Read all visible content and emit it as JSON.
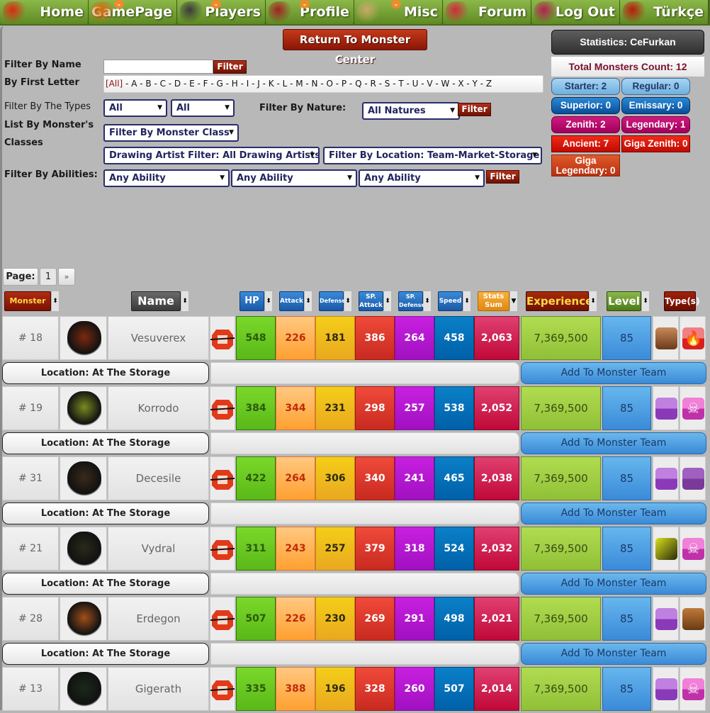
{
  "nav": [
    {
      "label": "Home",
      "dropdown": false,
      "sprite_color": "#d82a10"
    },
    {
      "label": "GamePage",
      "dropdown": true,
      "sprite_color": "#d86a10"
    },
    {
      "label": "Players",
      "dropdown": true,
      "sprite_color": "#3a3a3a"
    },
    {
      "label": "Profile",
      "dropdown": true,
      "sprite_color": "#a02020"
    },
    {
      "label": "Misc",
      "dropdown": true,
      "sprite_color": "#c8a868"
    },
    {
      "label": "Forum",
      "dropdown": false,
      "sprite_color": "#d02a3a"
    },
    {
      "label": "Log Out",
      "dropdown": false,
      "sprite_color": "#b02050"
    },
    {
      "label": "Türkçe",
      "dropdown": false,
      "sprite_color": "#b81a0a"
    }
  ],
  "return_button": "Return To Monster Center",
  "filters": {
    "name_label": "Filter By Name",
    "name_value": "",
    "filter_button": "Filter",
    "first_letter_label": "By First Letter",
    "letters_all": "[All]",
    "letters": "- A - B - C - D - E - F - G - H - I - J - K - L - M - N - O - P - Q - R - S - T - U - V - W - X - Y - Z",
    "types_label": "Filter By The Types",
    "type1": "All",
    "type2": "All",
    "nature_label": "Filter By Nature:",
    "nature": "All Natures",
    "classes_label_1": "List By Monster's",
    "classes_label_2": "Classes",
    "monster_class": "Filter By Monster Class",
    "artist": "Drawing Artist Filter: All Drawing Artists",
    "location": "Filter By Location: Team-Market-Storage",
    "abilities_label": "Filter By Abilities:",
    "ability1": "Any Ability",
    "ability2": "Any Ability",
    "ability3": "Any Ability"
  },
  "statistics": {
    "title": "Statistics: CeFurkan",
    "total": "Total Monsters Count: 12",
    "counts": [
      {
        "label": "Starter: 2",
        "style": "light"
      },
      {
        "label": "Regular: 0",
        "style": "light"
      },
      {
        "label": "Superior: 0",
        "style": "blue"
      },
      {
        "label": "Emissary: 0",
        "style": "blue"
      },
      {
        "label": "Zenith: 2",
        "style": "pink"
      },
      {
        "label": "Legendary: 1",
        "style": "pink"
      },
      {
        "label": "Ancient: 7",
        "style": "red"
      },
      {
        "label": "Giga Zenith: 0",
        "style": "red"
      },
      {
        "label": "Giga Legendary: 0",
        "style": "orange"
      }
    ]
  },
  "paging": {
    "label": "Page:",
    "current": "1",
    "next": "»"
  },
  "headers": {
    "id": "Monster ID",
    "name": "Name",
    "hp": "HP",
    "attack": "Attack",
    "defense": "Defense",
    "sp_attack": "SP. Attack",
    "sp_defense": "SP. Defense",
    "speed": "Speed",
    "stats_sum": "Stats Sum",
    "experience": "Experience",
    "level": "Level",
    "types": "Type(s)"
  },
  "monsters": [
    {
      "id": "# 18",
      "name": "Vesuverex",
      "hp": "548",
      "attack": "226",
      "defense": "181",
      "sp_attack": "386",
      "sp_defense": "264",
      "speed": "458",
      "sum": "2,063",
      "exp": "7,369,500",
      "level": "85",
      "types": [
        "earth",
        "fire"
      ],
      "location": "Location: At The Storage",
      "add": "Add To Monster Team",
      "portrait": "#7a2a10"
    },
    {
      "id": "# 19",
      "name": "Korrodo",
      "hp": "384",
      "attack": "344",
      "defense": "231",
      "sp_attack": "298",
      "sp_defense": "257",
      "speed": "538",
      "sum": "2,052",
      "exp": "7,369,500",
      "level": "85",
      "types": [
        "dragon",
        "poison"
      ],
      "location": "Location: At The Storage",
      "add": "Add To Monster Team",
      "portrait": "#7a8a20"
    },
    {
      "id": "# 31",
      "name": "Decesile",
      "hp": "422",
      "attack": "264",
      "defense": "306",
      "sp_attack": "340",
      "sp_defense": "241",
      "speed": "465",
      "sum": "2,038",
      "exp": "7,369,500",
      "level": "85",
      "types": [
        "dragon",
        "ghost"
      ],
      "location": "Location: At The Storage",
      "add": "Add To Monster Team",
      "portrait": "#3a2a1a"
    },
    {
      "id": "# 21",
      "name": "Vydral",
      "hp": "311",
      "attack": "243",
      "defense": "257",
      "sp_attack": "379",
      "sp_defense": "318",
      "speed": "524",
      "sum": "2,032",
      "exp": "7,369,500",
      "level": "85",
      "types": [
        "electric",
        "poison"
      ],
      "location": "Location: At The Storage",
      "add": "Add To Monster Team",
      "portrait": "#2a2a1a"
    },
    {
      "id": "# 28",
      "name": "Erdegon",
      "hp": "507",
      "attack": "226",
      "defense": "230",
      "sp_attack": "269",
      "sp_defense": "291",
      "speed": "498",
      "sum": "2,021",
      "exp": "7,369,500",
      "level": "85",
      "types": [
        "dragon",
        "ground"
      ],
      "location": "Location: At The Storage",
      "add": "Add To Monster Team",
      "portrait": "#a0501a"
    },
    {
      "id": "# 13",
      "name": "Gigerath",
      "hp": "335",
      "attack": "388",
      "defense": "196",
      "sp_attack": "328",
      "sp_defense": "260",
      "speed": "507",
      "sum": "2,014",
      "exp": "7,369,500",
      "level": "85",
      "types": [
        "dragon",
        "poison"
      ],
      "location": "",
      "add": "",
      "portrait": "#1a2a1a"
    }
  ]
}
